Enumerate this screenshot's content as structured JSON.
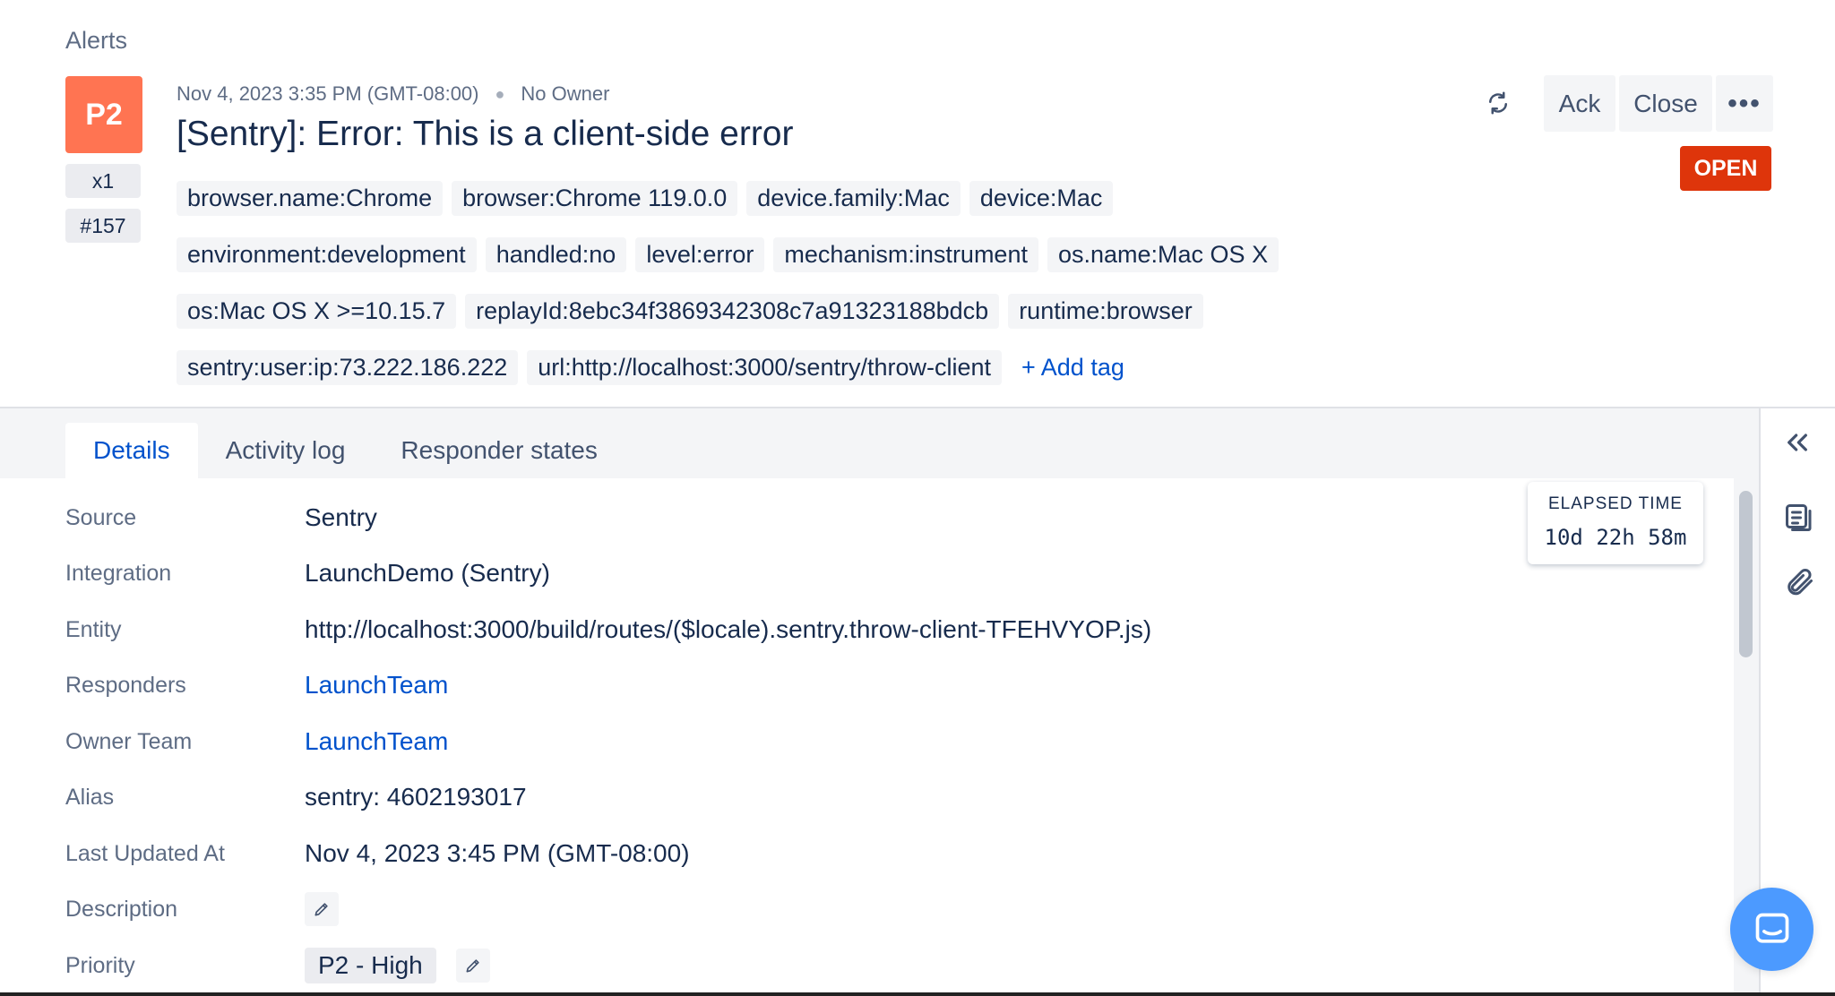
{
  "breadcrumb": "Alerts",
  "alert": {
    "priority_badge": "P2",
    "count_badge": "x1",
    "number_badge": "#157",
    "created_at": "Nov 4, 2023 3:35 PM (GMT-08:00)",
    "owner": "No Owner",
    "title": "[Sentry]: Error: This is a client-side error",
    "status": "OPEN",
    "status_color": "#de350b",
    "priority_color": "#ff7452",
    "tags": [
      "browser.name:Chrome",
      "browser:Chrome 119.0.0",
      "device.family:Mac",
      "device:Mac",
      "environment:development",
      "handled:no",
      "level:error",
      "mechanism:instrument",
      "os.name:Mac OS X",
      "os:Mac OS X >=10.15.7",
      "replayId:8ebc34f3869342308c7a91323188bdcb",
      "runtime:browser",
      "sentry:user:ip:73.222.186.222",
      "url:http://localhost:3000/sentry/throw-client"
    ],
    "add_tag_label": "+ Add tag"
  },
  "actions": {
    "sync_icon": "sync-icon",
    "ack_label": "Ack",
    "close_label": "Close",
    "more_label": "•••"
  },
  "tabs": [
    {
      "label": "Details",
      "active": true
    },
    {
      "label": "Activity log",
      "active": false
    },
    {
      "label": "Responder states",
      "active": false
    }
  ],
  "details": {
    "source": {
      "label": "Source",
      "value": "Sentry"
    },
    "integration": {
      "label": "Integration",
      "value": "LaunchDemo (Sentry)"
    },
    "entity": {
      "label": "Entity",
      "value": "http://localhost:3000/build/routes/($locale).sentry.throw-client-TFEHVYOP.js)"
    },
    "responders": {
      "label": "Responders",
      "value": "LaunchTeam"
    },
    "owner_team": {
      "label": "Owner Team",
      "value": "LaunchTeam"
    },
    "alias": {
      "label": "Alias",
      "value": "sentry: 4602193017"
    },
    "last_updated": {
      "label": "Last Updated At",
      "value": "Nov 4, 2023 3:45 PM (GMT-08:00)"
    },
    "description": {
      "label": "Description"
    },
    "priority": {
      "label": "Priority",
      "value": "P2 - High"
    }
  },
  "elapsed": {
    "label": "ELAPSED TIME",
    "value": "10d  22h  58m"
  },
  "rail_icons": [
    "chevrons-left-icon",
    "notes-icon",
    "paperclip-icon"
  ],
  "chat_icon": "chat-bubble-icon",
  "link_color": "#0052cc"
}
